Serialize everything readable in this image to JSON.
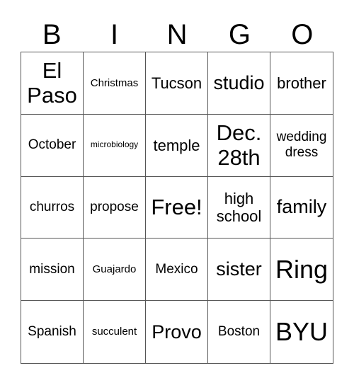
{
  "header": [
    "B",
    "I",
    "N",
    "G",
    "O"
  ],
  "cells": [
    {
      "text": "El Paso",
      "size": "xl"
    },
    {
      "text": "Christmas",
      "size": "xs"
    },
    {
      "text": "Tucson",
      "size": "m"
    },
    {
      "text": "studio",
      "size": "l"
    },
    {
      "text": "brother",
      "size": "m"
    },
    {
      "text": "October",
      "size": "s"
    },
    {
      "text": "microbiology",
      "size": "xxs"
    },
    {
      "text": "temple",
      "size": "m"
    },
    {
      "text": "Dec. 28th",
      "size": "xl"
    },
    {
      "text": "wedding dress",
      "size": "s"
    },
    {
      "text": "churros",
      "size": "s"
    },
    {
      "text": "propose",
      "size": "s"
    },
    {
      "text": "Free!",
      "size": "xl"
    },
    {
      "text": "high school",
      "size": "m"
    },
    {
      "text": "family",
      "size": "l"
    },
    {
      "text": "mission",
      "size": "s"
    },
    {
      "text": "Guajardo",
      "size": "xs"
    },
    {
      "text": "Mexico",
      "size": "s"
    },
    {
      "text": "sister",
      "size": "l"
    },
    {
      "text": "Ring",
      "size": "xxl"
    },
    {
      "text": "Spanish",
      "size": "s"
    },
    {
      "text": "succulent",
      "size": "xs"
    },
    {
      "text": "Provo",
      "size": "l"
    },
    {
      "text": "Boston",
      "size": "s"
    },
    {
      "text": "BYU",
      "size": "xxl"
    }
  ]
}
